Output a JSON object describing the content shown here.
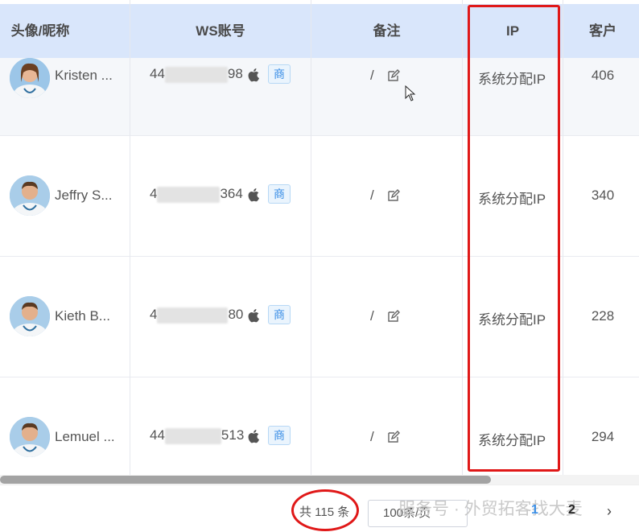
{
  "columns": [
    "头像/昵称",
    "WS账号",
    "备注",
    "IP",
    "客户"
  ],
  "rows": [
    {
      "name": "Kristen ...",
      "ws_prefix": "44",
      "ws_suffix": "98",
      "tag": "商",
      "remark": "/",
      "ip": "系统分配IP",
      "customers": "406"
    },
    {
      "name": "Jeffry S...",
      "ws_prefix": "4",
      "ws_suffix": "364",
      "tag": "商",
      "remark": "/",
      "ip": "系统分配IP",
      "customers": "340"
    },
    {
      "name": "Kieth B...",
      "ws_prefix": "4",
      "ws_suffix": "80",
      "tag": "商",
      "remark": "/",
      "ip": "系统分配IP",
      "customers": "228"
    },
    {
      "name": "Lemuel ...",
      "ws_prefix": "44",
      "ws_suffix": "513",
      "tag": "商",
      "remark": "/",
      "ip": "系统分配IP",
      "customers": "294"
    }
  ],
  "pagination": {
    "total": "共 115 条",
    "page_size": "100条/页",
    "pages": [
      "1",
      "2"
    ],
    "next": "›"
  },
  "watermark": "服务号 · 外贸拓客找大麦",
  "colors": {
    "header_bg": "#d9e6fb",
    "highlight": "#e01818",
    "accent": "#3a8ee6"
  }
}
